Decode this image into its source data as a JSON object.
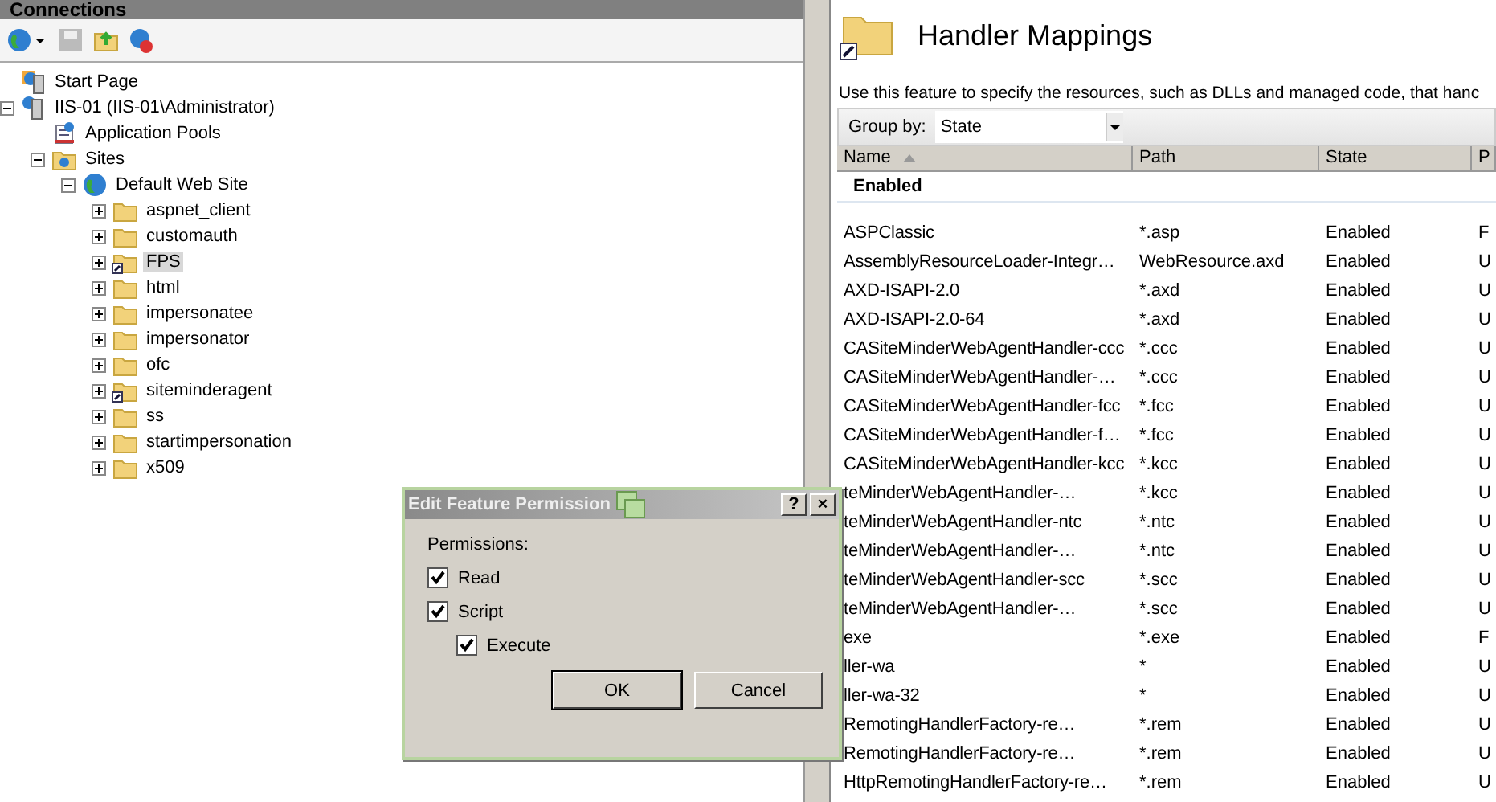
{
  "connections": {
    "title": "Connections",
    "tree": [
      {
        "label": "Start Page",
        "kind": "page",
        "selected": false
      },
      {
        "label": "IIS-01 (IIS-01\\Administrator)",
        "kind": "server",
        "expanded": true,
        "selected": false,
        "children": [
          {
            "label": "Application Pools",
            "kind": "pools",
            "selected": false
          },
          {
            "label": "Sites",
            "kind": "sites",
            "expanded": true,
            "selected": false,
            "children": [
              {
                "label": "Default Web Site",
                "kind": "globe",
                "expanded": true,
                "selected": false,
                "children": [
                  {
                    "label": "aspnet_client",
                    "kind": "folder",
                    "expanded": false,
                    "selected": false
                  },
                  {
                    "label": "customauth",
                    "kind": "folder",
                    "expanded": false,
                    "selected": false
                  },
                  {
                    "label": "FPS",
                    "kind": "virtual",
                    "expanded": false,
                    "selected": true
                  },
                  {
                    "label": "html",
                    "kind": "folder",
                    "expanded": false,
                    "selected": false
                  },
                  {
                    "label": "impersonatee",
                    "kind": "folder",
                    "expanded": false,
                    "selected": false
                  },
                  {
                    "label": "impersonator",
                    "kind": "folder",
                    "expanded": false,
                    "selected": false
                  },
                  {
                    "label": "ofc",
                    "kind": "folder",
                    "expanded": false,
                    "selected": false
                  },
                  {
                    "label": "siteminderagent",
                    "kind": "virtual",
                    "expanded": false,
                    "selected": false
                  },
                  {
                    "label": "ss",
                    "kind": "folder",
                    "expanded": false,
                    "selected": false
                  },
                  {
                    "label": "startimpersonation",
                    "kind": "folder",
                    "expanded": false,
                    "selected": false
                  },
                  {
                    "label": "x509",
                    "kind": "folder",
                    "expanded": false,
                    "selected": false
                  }
                ]
              }
            ]
          }
        ]
      }
    ]
  },
  "feature": {
    "title": "Handler Mappings",
    "description": "Use this feature to specify the resources, such as DLLs and managed code, that hanc",
    "group_by": {
      "label": "Group by:",
      "value": "State"
    },
    "columns": [
      "Name",
      "Path",
      "State",
      "P"
    ],
    "group": "Enabled",
    "rows": [
      [
        "ASPClassic",
        "*.asp",
        "Enabled",
        "F"
      ],
      [
        "AssemblyResourceLoader-Integr…",
        "WebResource.axd",
        "Enabled",
        "U"
      ],
      [
        "AXD-ISAPI-2.0",
        "*.axd",
        "Enabled",
        "U"
      ],
      [
        "AXD-ISAPI-2.0-64",
        "*.axd",
        "Enabled",
        "U"
      ],
      [
        "CASiteMinderWebAgentHandler-ccc",
        "*.ccc",
        "Enabled",
        "U"
      ],
      [
        "CASiteMinderWebAgentHandler-…",
        "*.ccc",
        "Enabled",
        "U"
      ],
      [
        "CASiteMinderWebAgentHandler-fcc",
        "*.fcc",
        "Enabled",
        "U"
      ],
      [
        "CASiteMinderWebAgentHandler-f…",
        "*.fcc",
        "Enabled",
        "U"
      ],
      [
        "CASiteMinderWebAgentHandler-kcc",
        "*.kcc",
        "Enabled",
        "U"
      ],
      [
        "teMinderWebAgentHandler-…",
        "*.kcc",
        "Enabled",
        "U"
      ],
      [
        "teMinderWebAgentHandler-ntc",
        "*.ntc",
        "Enabled",
        "U"
      ],
      [
        "teMinderWebAgentHandler-…",
        "*.ntc",
        "Enabled",
        "U"
      ],
      [
        "teMinderWebAgentHandler-scc",
        "*.scc",
        "Enabled",
        "U"
      ],
      [
        "teMinderWebAgentHandler-…",
        "*.scc",
        "Enabled",
        "U"
      ],
      [
        "exe",
        "*.exe",
        "Enabled",
        "F"
      ],
      [
        "ller-wa",
        "*",
        "Enabled",
        "U"
      ],
      [
        "ller-wa-32",
        "*",
        "Enabled",
        "U"
      ],
      [
        "RemotingHandlerFactory-re…",
        "*.rem",
        "Enabled",
        "U"
      ],
      [
        "RemotingHandlerFactory-re…",
        "*.rem",
        "Enabled",
        "U"
      ],
      [
        "HttpRemotingHandlerFactory-re…",
        "*.rem",
        "Enabled",
        "U"
      ]
    ]
  },
  "dialog": {
    "title": "Edit Feature Permission",
    "help": "?",
    "close": "×",
    "heading": "Permissions:",
    "options": [
      {
        "label": "Read",
        "checked": true,
        "indented": false
      },
      {
        "label": "Script",
        "checked": true,
        "indented": false
      },
      {
        "label": "Execute",
        "checked": true,
        "indented": true
      }
    ],
    "buttons": [
      {
        "label": "OK",
        "default": true
      },
      {
        "label": "Cancel",
        "default": false
      }
    ]
  }
}
